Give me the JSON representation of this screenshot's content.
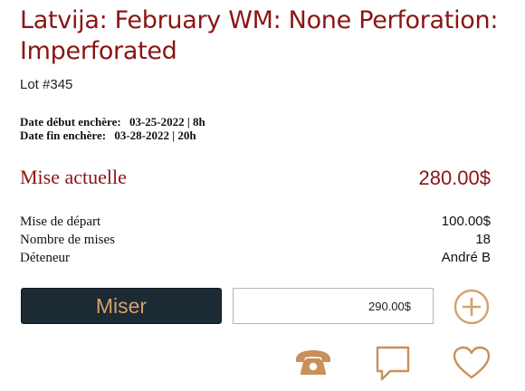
{
  "lot": {
    "title": "Latvija: February WM: None Perforation: Imperforated",
    "number": "Lot #345",
    "start_label": "Date début enchère:",
    "start_value": "03-25-2022 | 8h",
    "end_label": "Date fin enchère:",
    "end_value": "03-28-2022 | 20h"
  },
  "current_bid": {
    "label": "Mise actuelle",
    "value": "280.00$"
  },
  "details": [
    {
      "label": "Mise de départ",
      "value": "100.00$"
    },
    {
      "label": "Nombre de mises",
      "value": "18"
    },
    {
      "label": "Déteneur",
      "value": "André B"
    }
  ],
  "bid_form": {
    "button_label": "Miser",
    "amount_value": "290.00$"
  },
  "icons": {
    "add": "plus-circle-icon",
    "phone": "phone-icon",
    "chat": "chat-bubble-icon",
    "favorite": "heart-icon"
  },
  "colors": {
    "title": "#8b1414",
    "button_bg": "#1c2a33",
    "accent": "#d6a06c"
  }
}
